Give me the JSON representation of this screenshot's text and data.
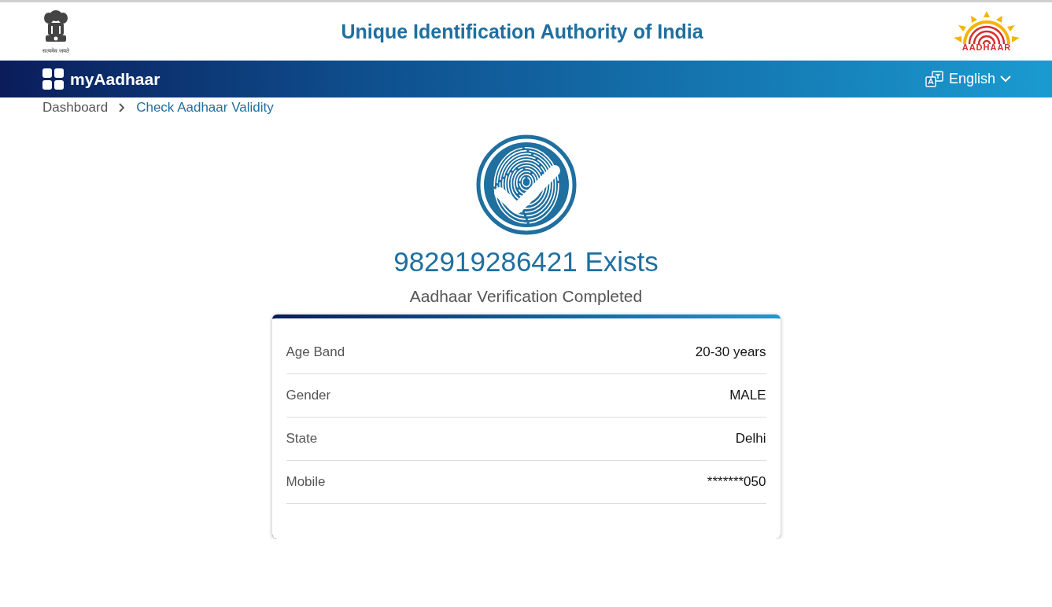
{
  "header": {
    "emblem_motto": "सत्यमेव जयते",
    "title": "Unique Identification Authority of India",
    "logo_text": "AADHAAR"
  },
  "navbar": {
    "brand": "myAadhaar",
    "language": "English"
  },
  "breadcrumb": [
    {
      "label": "Dashboard",
      "current": false
    },
    {
      "label": "Check Aadhaar Validity",
      "current": true
    }
  ],
  "result": {
    "heading": "982919286421 Exists",
    "subheading": "Aadhaar Verification Completed"
  },
  "details": [
    {
      "label": "Age Band",
      "value": "20-30 years"
    },
    {
      "label": "Gender",
      "value": "MALE"
    },
    {
      "label": "State",
      "value": "Delhi"
    },
    {
      "label": "Mobile",
      "value": "*******050"
    }
  ]
}
